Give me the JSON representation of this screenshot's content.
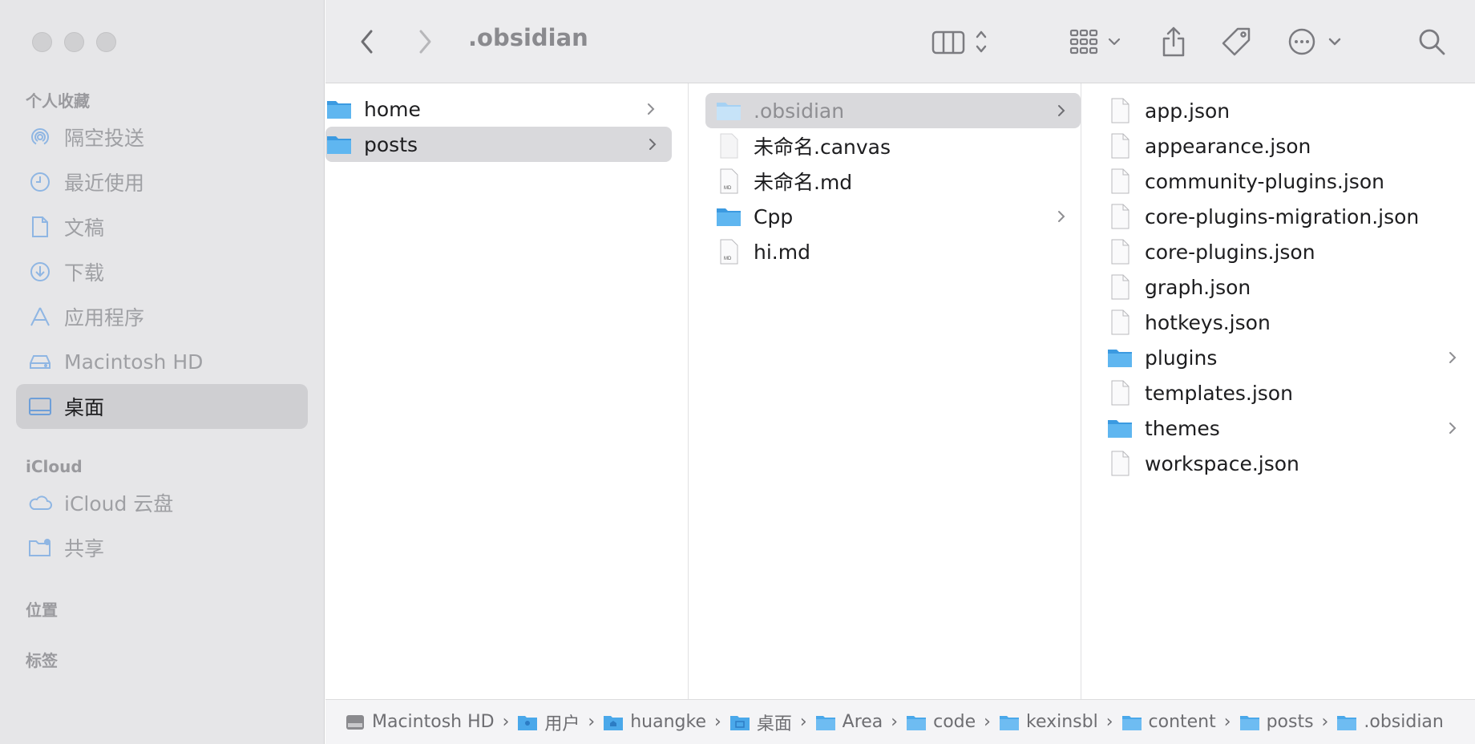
{
  "toolbar": {
    "title": ".obsidian",
    "icons": [
      "back-chevron-icon",
      "forward-chevron-icon",
      "column-view-icon",
      "group-grid-icon",
      "share-icon",
      "tag-icon",
      "more-icon",
      "search-icon"
    ]
  },
  "sidebar": {
    "sections": [
      {
        "title": "个人收藏"
      },
      {
        "title": "iCloud"
      },
      {
        "title": "位置"
      },
      {
        "title": "标签"
      }
    ],
    "items": [
      {
        "label": "隔空投送",
        "icon": "airdrop-icon"
      },
      {
        "label": "最近使用",
        "icon": "clock-icon"
      },
      {
        "label": "文稿",
        "icon": "document-icon"
      },
      {
        "label": "下载",
        "icon": "download-icon"
      },
      {
        "label": "应用程序",
        "icon": "applications-icon"
      },
      {
        "label": "Macintosh HD",
        "icon": "hard-drive-icon"
      },
      {
        "label": "桌面",
        "icon": "desktop-icon",
        "selected": true
      },
      {
        "label": "iCloud 云盘",
        "icon": "cloud-icon"
      },
      {
        "label": "共享",
        "icon": "shared-folder-icon"
      }
    ]
  },
  "columns": {
    "col1": [
      {
        "label": "home",
        "type": "folder"
      },
      {
        "label": "posts",
        "type": "folder",
        "selected": true
      }
    ],
    "col2": [
      {
        "label": ".obsidian",
        "type": "folder",
        "selected": true
      },
      {
        "label": "未命名.canvas",
        "type": "file"
      },
      {
        "label": "未命名.md",
        "type": "md"
      },
      {
        "label": "Cpp",
        "type": "folder"
      },
      {
        "label": "hi.md",
        "type": "md"
      }
    ],
    "col3": [
      {
        "label": "app.json",
        "type": "file"
      },
      {
        "label": "appearance.json",
        "type": "file"
      },
      {
        "label": "community-plugins.json",
        "type": "file"
      },
      {
        "label": "core-plugins-migration.json",
        "type": "file"
      },
      {
        "label": "core-plugins.json",
        "type": "file"
      },
      {
        "label": "graph.json",
        "type": "file"
      },
      {
        "label": "hotkeys.json",
        "type": "file"
      },
      {
        "label": "plugins",
        "type": "folder"
      },
      {
        "label": "templates.json",
        "type": "file"
      },
      {
        "label": "themes",
        "type": "folder"
      },
      {
        "label": "workspace.json",
        "type": "file"
      }
    ]
  },
  "pathbar": [
    {
      "label": "Macintosh HD",
      "icon": "hard-drive-icon"
    },
    {
      "label": "用户",
      "icon": "users-folder-icon"
    },
    {
      "label": "huangke",
      "icon": "home-folder-icon"
    },
    {
      "label": "桌面",
      "icon": "desktop-folder-icon"
    },
    {
      "label": "Area",
      "icon": "folder-icon"
    },
    {
      "label": "code",
      "icon": "folder-icon"
    },
    {
      "label": "kexinsbl",
      "icon": "folder-icon"
    },
    {
      "label": "content",
      "icon": "folder-icon"
    },
    {
      "label": "posts",
      "icon": "folder-icon"
    },
    {
      "label": ".obsidian",
      "icon": "folder-icon"
    }
  ],
  "colors": {
    "folder": "#4aa8ea",
    "folder_light": "#bfe0f7",
    "sidebar_icon": "#8fb6e3",
    "selection": "#d9d9dc"
  }
}
